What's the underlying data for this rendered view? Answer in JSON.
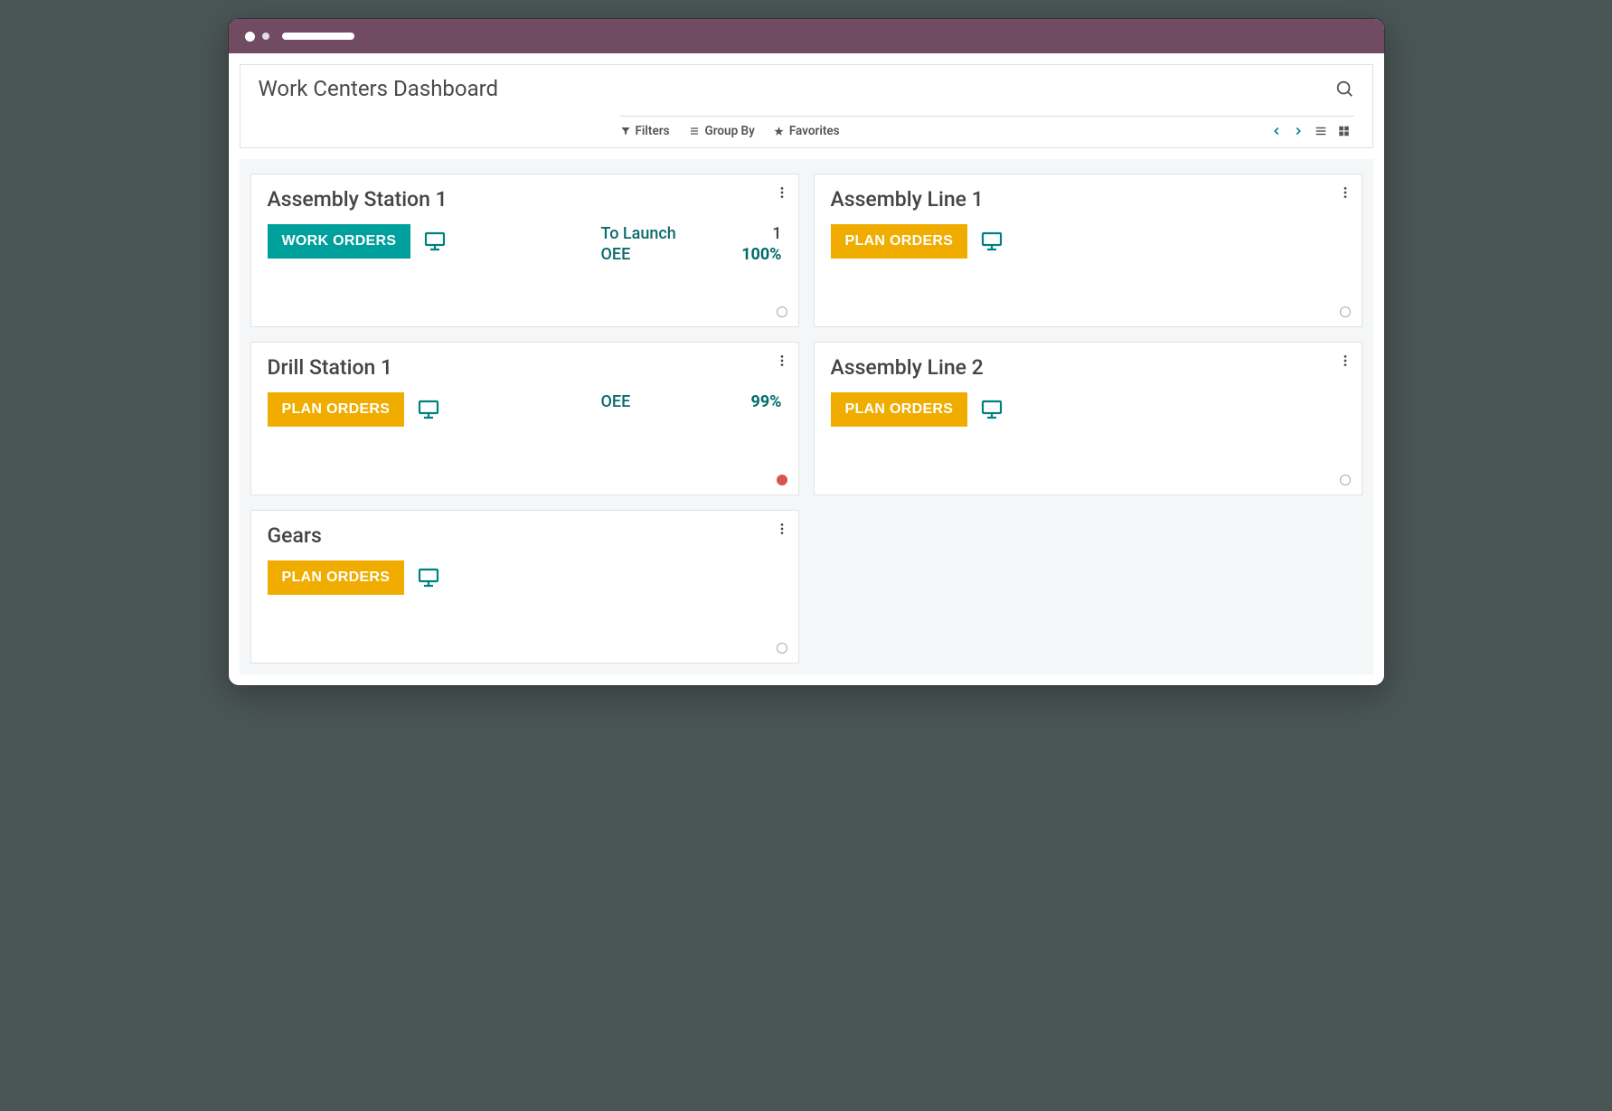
{
  "page_title": "Work Centers Dashboard",
  "toolbar": {
    "filters": "Filters",
    "group_by": "Group By",
    "favorites": "Favorites"
  },
  "buttons": {
    "work_orders": "WORK ORDERS",
    "plan_orders": "PLAN ORDERS"
  },
  "cards": [
    {
      "title": "Assembly Station 1",
      "button_type": "work",
      "stats": [
        {
          "label": "To Launch",
          "value": "1",
          "bold": false
        },
        {
          "label": "OEE",
          "value": "100%",
          "bold": true
        }
      ],
      "status": "empty"
    },
    {
      "title": "Assembly Line 1",
      "button_type": "plan",
      "stats": [],
      "status": "empty"
    },
    {
      "title": "Drill Station 1",
      "button_type": "plan",
      "stats": [
        {
          "label": "OEE",
          "value": "99%",
          "bold": true
        }
      ],
      "status": "red"
    },
    {
      "title": "Assembly Line 2",
      "button_type": "plan",
      "stats": [],
      "status": "empty"
    },
    {
      "title": "Gears",
      "button_type": "plan",
      "stats": [],
      "status": "empty"
    }
  ]
}
